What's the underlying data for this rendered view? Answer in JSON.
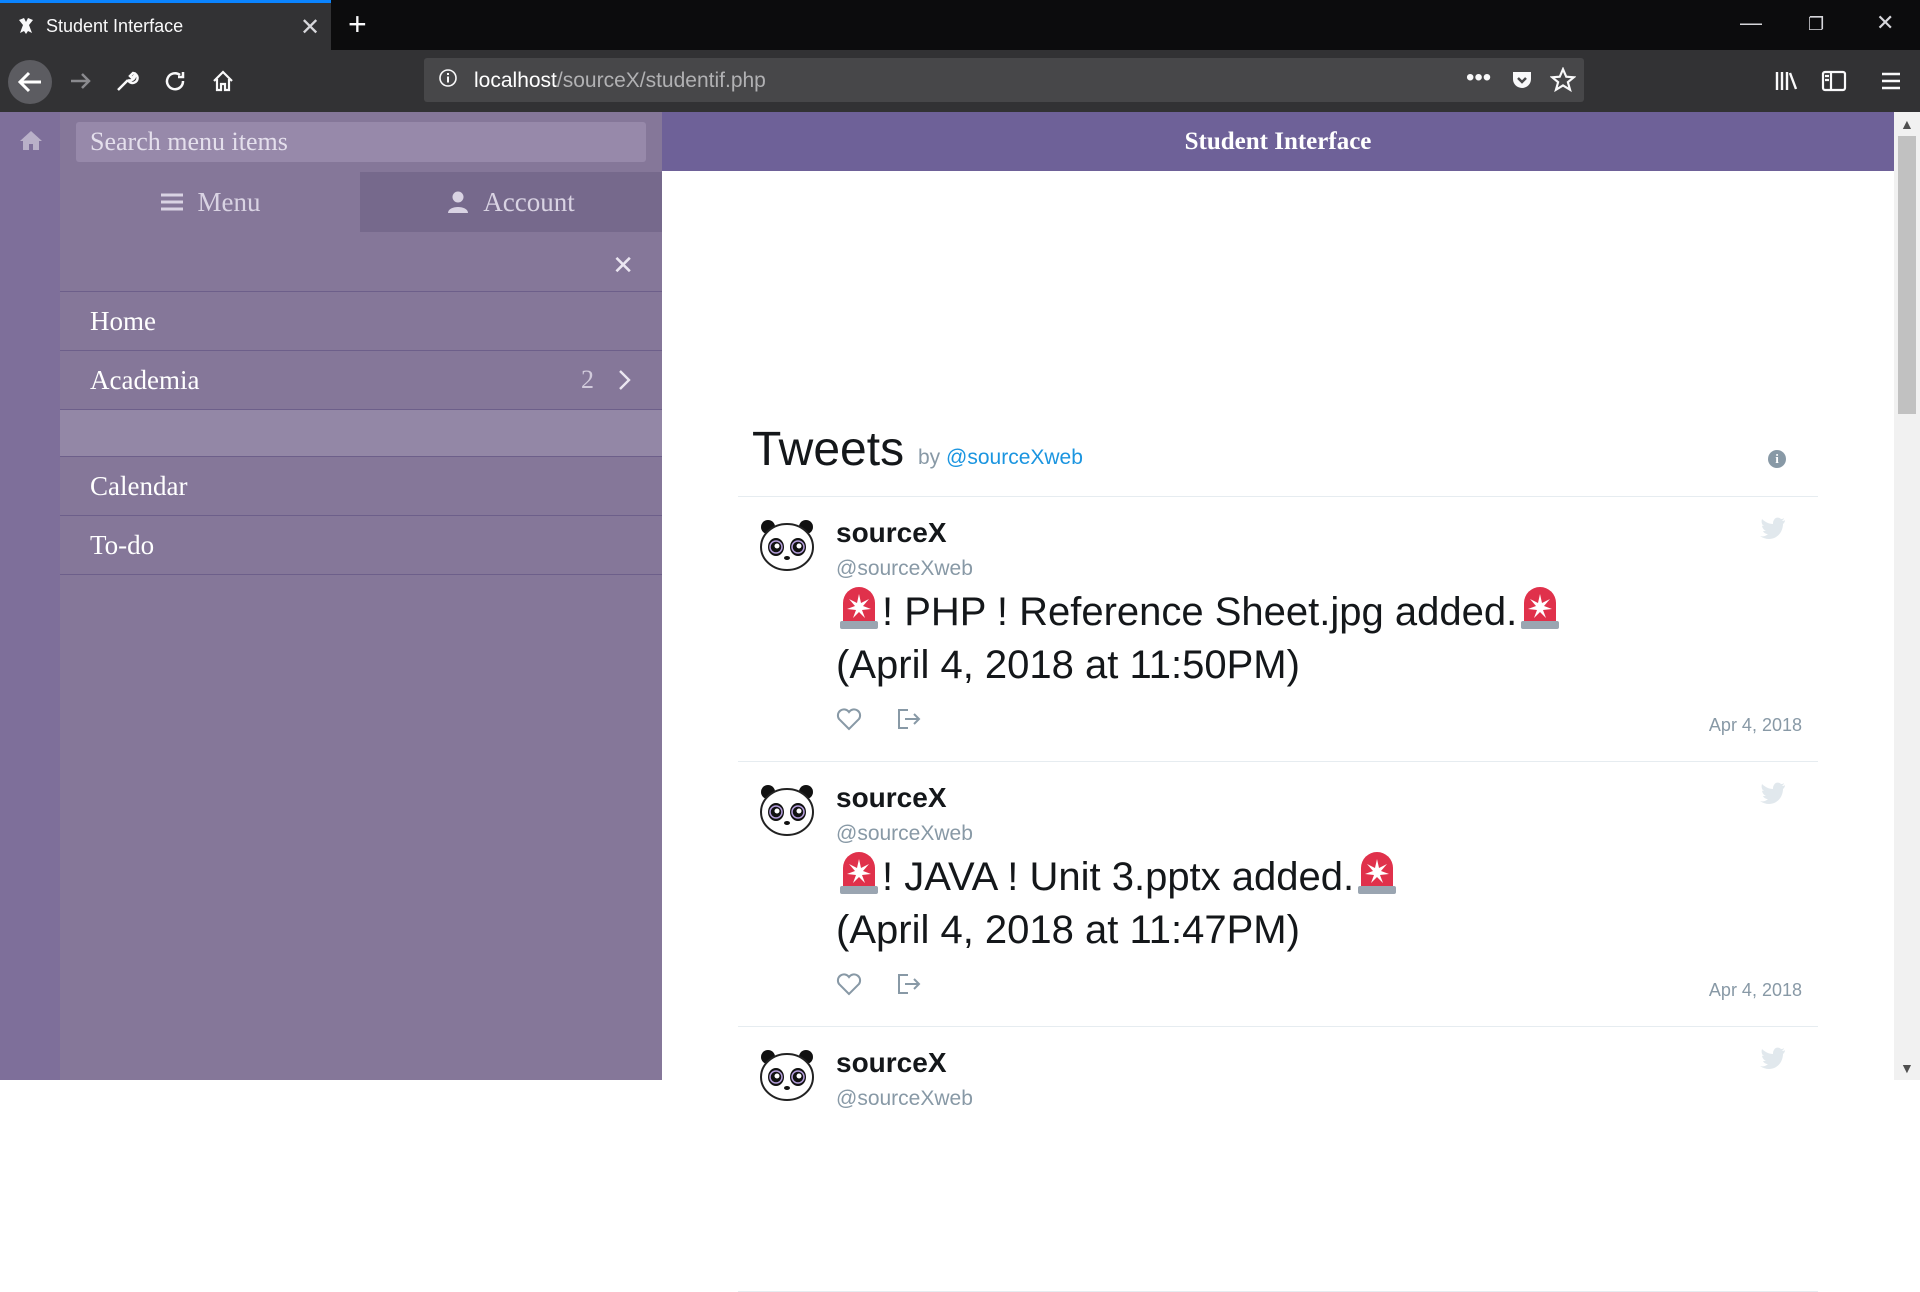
{
  "browser": {
    "tab_title": "Student Interface",
    "url_host": "localhost",
    "url_path": "/sourceX/studentif.php",
    "tab_accent": "#0a84ff"
  },
  "sidebar": {
    "search_placeholder": "Search menu items",
    "tabs": [
      {
        "label": "Menu",
        "icon": "bars-icon"
      },
      {
        "label": "Account",
        "icon": "user-icon"
      }
    ],
    "items": [
      {
        "label": "Home"
      },
      {
        "label": "Academia",
        "count": "2"
      },
      {
        "label": ""
      },
      {
        "label": "Calendar"
      },
      {
        "label": "To-do"
      }
    ],
    "color": "#857799"
  },
  "header": {
    "title": "Student Interface",
    "color": "#6e6198"
  },
  "timeline": {
    "title": "Tweets",
    "by_text": "by",
    "by_handle": "@sourceXweb",
    "tweets": [
      {
        "name": "sourceX",
        "handle": "@sourceXweb",
        "text1": "! PHP ! Reference Sheet.jpg added.",
        "text2": "(April 4, 2018 at 11:50PM)",
        "date": "Apr 4, 2018"
      },
      {
        "name": "sourceX",
        "handle": "@sourceXweb",
        "text1": "! JAVA ! Unit 3.pptx added.",
        "text2": "(April 4, 2018 at 11:47PM)",
        "date": "Apr 4, 2018"
      },
      {
        "name": "sourceX",
        "handle": "@sourceXweb"
      }
    ]
  }
}
